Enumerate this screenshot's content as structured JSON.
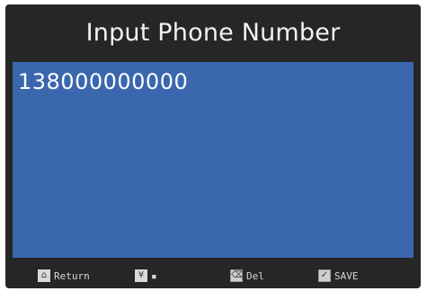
{
  "header": {
    "title": "Input Phone Number"
  },
  "input": {
    "value": "138000000000"
  },
  "footer": {
    "return": {
      "icon": "home-icon",
      "glyph": "⌂",
      "label": "Return"
    },
    "toggle": {
      "icon": "down-arrows-icon",
      "glyph": "¥",
      "label": "▪"
    },
    "delete": {
      "icon": "delete-icon",
      "glyph": "⌫",
      "label": "Del"
    },
    "save": {
      "icon": "save-check-icon",
      "glyph": "✓",
      "label": "SAVE"
    }
  },
  "colors": {
    "device_bg": "#262626",
    "screen_bg": "#3a67ae",
    "text": "#ffffff"
  }
}
